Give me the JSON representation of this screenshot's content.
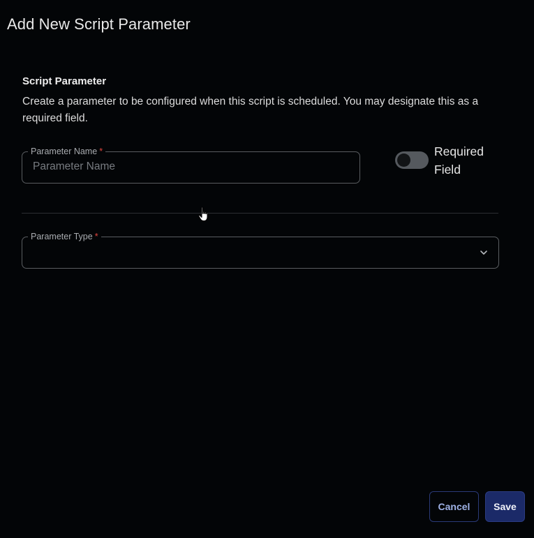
{
  "dialog": {
    "title": "Add New Script Parameter"
  },
  "section": {
    "title": "Script Parameter",
    "description": "Create a parameter to be configured when this script is scheduled. You may designate this as a required field."
  },
  "parameter_name": {
    "label": "Parameter Name",
    "required_mark": "*",
    "placeholder": "Parameter Name",
    "value": ""
  },
  "required_toggle": {
    "label": "Required Field",
    "checked": false
  },
  "parameter_type": {
    "label": "Parameter Type",
    "required_mark": "*",
    "value": ""
  },
  "actions": {
    "cancel_label": "Cancel",
    "save_label": "Save"
  },
  "colors": {
    "background": "#030507",
    "accent": "#1b2a68",
    "required": "#e0463f",
    "toggle_off": "#55595e"
  }
}
